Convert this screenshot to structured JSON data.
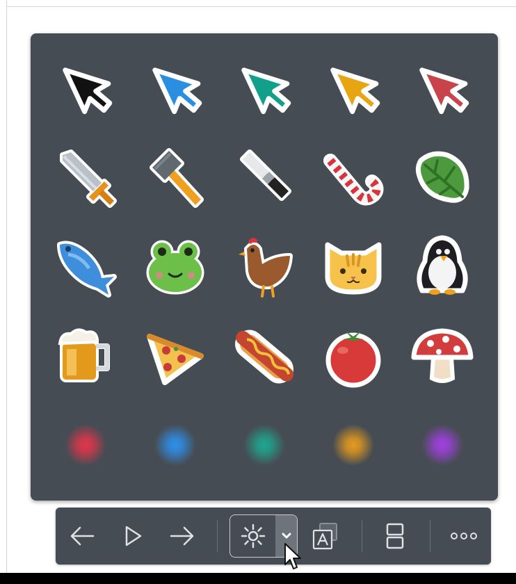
{
  "panel": {
    "rows": [
      [
        "arrow-cursor-black-icon",
        "arrow-cursor-blue-icon",
        "arrow-cursor-teal-icon",
        "arrow-cursor-orange-icon",
        "arrow-cursor-red-icon"
      ],
      [
        "sword-icon",
        "hammer-icon",
        "marker-pen-icon",
        "candy-cane-icon",
        "leaf-icon"
      ],
      [
        "fish-icon",
        "frog-icon",
        "chicken-icon",
        "cat-icon",
        "penguin-icon"
      ],
      [
        "beer-mug-icon",
        "pizza-slice-icon",
        "hot-dog-icon",
        "tomato-icon",
        "mushroom-icon"
      ],
      [
        "glow-dot-red-icon",
        "glow-dot-blue-icon",
        "glow-dot-teal-icon",
        "glow-dot-orange-icon",
        "glow-dot-purple-icon"
      ]
    ],
    "cursor_colors": [
      "#111111",
      "#2a8fe0",
      "#12a08a",
      "#e8a512",
      "#c9434b"
    ],
    "glow_colors": [
      "#e0364a",
      "#2e8fe8",
      "#1fa58f",
      "#e59a1d",
      "#a040e0"
    ]
  },
  "toolbar": {
    "items": [
      "arrow-left-icon",
      "play-icon",
      "arrow-right-icon",
      "laser-pointer-icon",
      "chevron-down-icon",
      "text-annotation-icon",
      "split-view-icon",
      "more-icon"
    ]
  },
  "colors": {
    "panel_bg": "#464c53",
    "icon_stroke": "#dfe2e5"
  }
}
